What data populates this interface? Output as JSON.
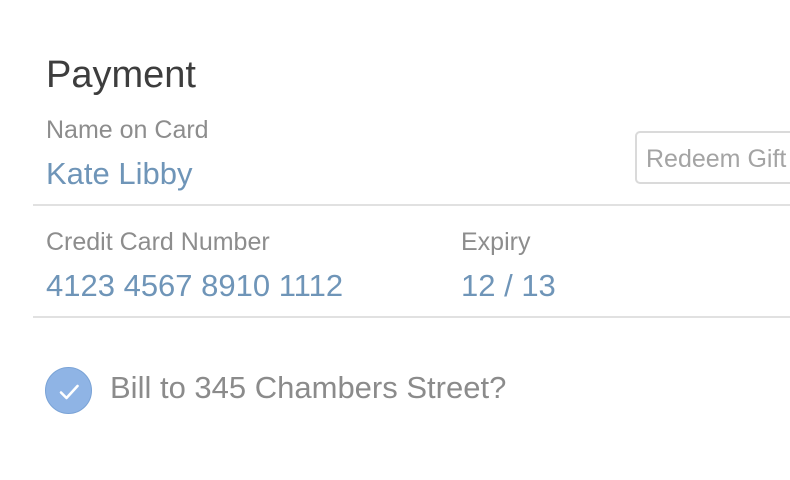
{
  "payment": {
    "title": "Payment",
    "name_on_card": {
      "label": "Name on Card",
      "value": "Kate Libby"
    },
    "gift_button_label": "Redeem Gift",
    "credit_card_number": {
      "label": "Credit Card Number",
      "value": "4123 4567 8910 1112"
    },
    "expiry": {
      "label": "Expiry",
      "value": "12 / 13"
    },
    "billing": {
      "checked": true,
      "label": "Bill to 345 Chambers Street?"
    }
  },
  "colors": {
    "value_text": "#6f95b8",
    "checkbox_fill": "#8fb4e5"
  },
  "icons": {
    "checkbox": "checkmark-icon"
  }
}
